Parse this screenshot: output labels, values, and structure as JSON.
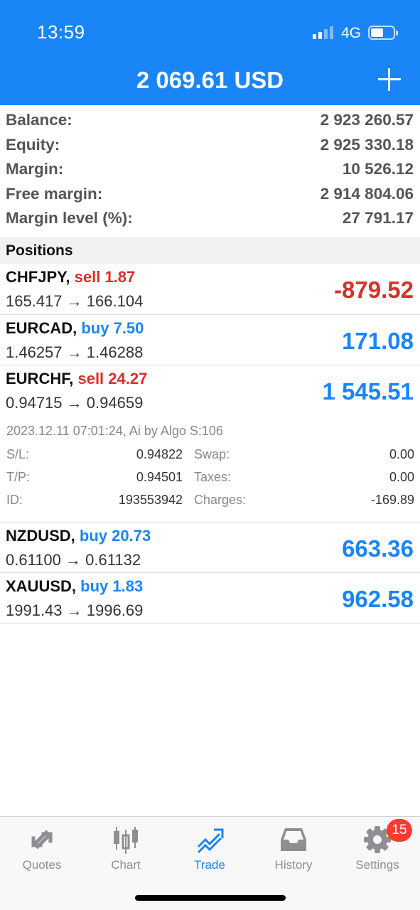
{
  "status_bar": {
    "time": "13:59",
    "network": "4G"
  },
  "header": {
    "title": "2 069.61 USD"
  },
  "account": {
    "rows": [
      {
        "label": "Balance:",
        "value": "2 923 260.57"
      },
      {
        "label": "Equity:",
        "value": "2 925 330.18"
      },
      {
        "label": "Margin:",
        "value": "10 526.12"
      },
      {
        "label": "Free margin:",
        "value": "2 914 804.06"
      },
      {
        "label": "Margin level (%):",
        "value": "27 791.17"
      }
    ]
  },
  "positions_section": {
    "title": "Positions"
  },
  "positions": [
    {
      "symbol": "CHFJPY,",
      "side_volume": "sell 1.87",
      "side": "sell",
      "open": "165.417",
      "arrow": "→",
      "current": "166.104",
      "profit": "-879.52"
    },
    {
      "symbol": "EURCAD,",
      "side_volume": "buy 7.50",
      "side": "buy",
      "open": "1.46257",
      "arrow": "→",
      "current": "1.46288",
      "profit": "171.08"
    },
    {
      "symbol": "EURCHF,",
      "side_volume": "sell 24.27",
      "side": "sell",
      "open": "0.94715",
      "arrow": "→",
      "current": "0.94659",
      "profit": "1 545.51"
    },
    {
      "symbol": "NZDUSD,",
      "side_volume": "buy 20.73",
      "side": "buy",
      "open": "0.61100",
      "arrow": "→",
      "current": "0.61132",
      "profit": "663.36"
    },
    {
      "symbol": "XAUUSD,",
      "side_volume": "buy 1.83",
      "side": "buy",
      "open": "1991.43",
      "arrow": "→",
      "current": "1996.69",
      "profit": "962.58"
    }
  ],
  "expanded_details": {
    "meta": "2023.12.11 07:01:24, Ai by Algo S:106",
    "rows": [
      {
        "k1": "S/L:",
        "v1": "0.94822",
        "k2": "Swap:",
        "v2": "0.00"
      },
      {
        "k1": "T/P:",
        "v1": "0.94501",
        "k2": "Taxes:",
        "v2": "0.00"
      },
      {
        "k1": "ID:",
        "v1": "193553942",
        "k2": "Charges:",
        "v2": "-169.89"
      }
    ]
  },
  "tabbar": {
    "tabs": [
      {
        "label": "Quotes",
        "icon": "quotes-arrows-icon"
      },
      {
        "label": "Chart",
        "icon": "candlestick-icon"
      },
      {
        "label": "Trade",
        "icon": "trade-trend-icon",
        "active": true
      },
      {
        "label": "History",
        "icon": "inbox-tray-icon"
      },
      {
        "label": "Settings",
        "icon": "gear-icon"
      }
    ],
    "settings_badge": "15"
  },
  "colors": {
    "accent": "#1a85f7",
    "loss": "#d6312c",
    "badge": "#ff3b30"
  }
}
